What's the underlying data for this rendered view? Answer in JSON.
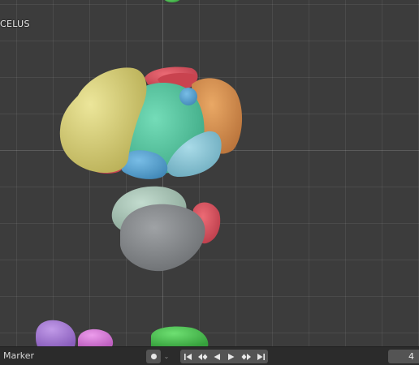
{
  "viewport": {
    "object_label": "CELUS"
  },
  "timeline": {
    "marker_label": "Marker",
    "record_icon": "record-dot-icon",
    "record_dropdown_icon": "chevron-down-icon",
    "transport_icons": [
      "jump-to-start-icon",
      "jump-to-keyframe-prev-icon",
      "play-reverse-icon",
      "play-icon",
      "jump-to-keyframe-next-icon",
      "jump-to-end-icon"
    ],
    "current_frame": "4"
  },
  "colors": {
    "yellow_region": "#d9d27a",
    "teal_region": "#5cc9a4",
    "orange_region": "#d9914e",
    "red_region": "#d9535f",
    "blue_region": "#5ea9d4",
    "light_blue_region": "#8fc8d8",
    "gray_region": "#8a8d90",
    "pale_green_region": "#a9c4b6",
    "purple_region": "#a97ed6",
    "pink_region": "#d97ed8",
    "green_region": "#4fc455"
  }
}
